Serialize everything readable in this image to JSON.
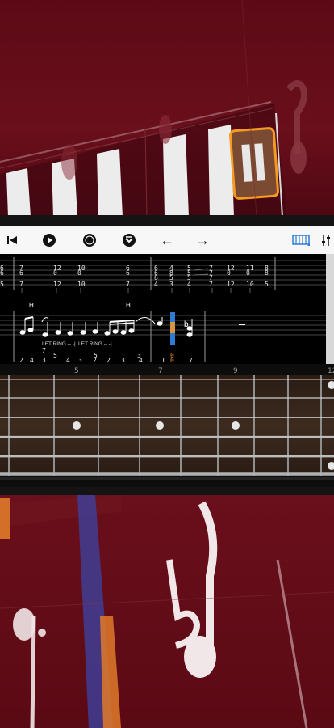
{
  "toolbar": {
    "items": [
      "skip-to-start",
      "play",
      "record",
      "loop-mode",
      "previous",
      "next",
      "piano-view",
      "settings"
    ],
    "prev_arrow": "←",
    "next_arrow": "→"
  },
  "score": {
    "top_system": {
      "measure1": [
        "7",
        "7",
        "12",
        "12",
        "10",
        "10",
        "7"
      ],
      "measure2": [
        "6",
        "6",
        "5",
        "4",
        "8",
        "7",
        "6",
        "5",
        "7",
        "7",
        "12",
        "12",
        "12",
        "10",
        "10",
        "11",
        "11",
        "10"
      ]
    },
    "bottom_system": {
      "hammer_labels": [
        "H",
        "H"
      ],
      "let_ring_1": "LET RING -- -|",
      "let_ring_2": "LET RING -- -|",
      "tab_numbers": [
        "7",
        "5",
        "3",
        "4",
        "4",
        "2",
        "3",
        "5",
        "2",
        "2",
        "4",
        "3",
        "1",
        "4"
      ],
      "highlighted": [
        "0",
        "0",
        "0"
      ]
    }
  },
  "fretboard": {
    "fret_numbers": [
      "5",
      "7",
      "9",
      "12"
    ],
    "string_count": 6
  },
  "colors": {
    "accent_blue": "#2e7bd6",
    "highlight_orange": "#f59a23",
    "wood": "#3a2a20",
    "background": "#5a0a14"
  }
}
